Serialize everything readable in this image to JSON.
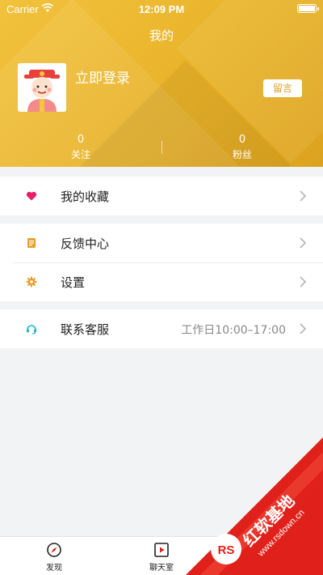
{
  "status_bar": {
    "carrier": "Carrier",
    "time": "12:09 PM"
  },
  "header": {
    "title": "我的",
    "login_label": "立即登录",
    "message_button": "留言",
    "stats": [
      {
        "count": "0",
        "label": "关注"
      },
      {
        "count": "0",
        "label": "粉丝"
      }
    ]
  },
  "menu": {
    "favorites": {
      "label": "我的收藏",
      "icon": "heart-icon"
    },
    "feedback": {
      "label": "反馈中心",
      "icon": "document-icon"
    },
    "settings": {
      "label": "设置",
      "icon": "gear-icon"
    },
    "support": {
      "label": "联系客服",
      "value": "工作日10:00–17:00",
      "icon": "headset-icon"
    }
  },
  "tabbar": {
    "discover": {
      "label": "发现",
      "icon": "compass-icon"
    },
    "chat": {
      "label": "聊天室",
      "icon": "play-square-icon"
    }
  },
  "watermark": {
    "brand": "红软基地",
    "site": "www.rsdown.cn",
    "badge": "RS"
  },
  "colors": {
    "header": "#e8b228",
    "accent_pink": "#e91e63",
    "accent_orange": "#e8a030",
    "accent_teal": "#1fb6c9",
    "watermark_red": "#e0201a"
  }
}
